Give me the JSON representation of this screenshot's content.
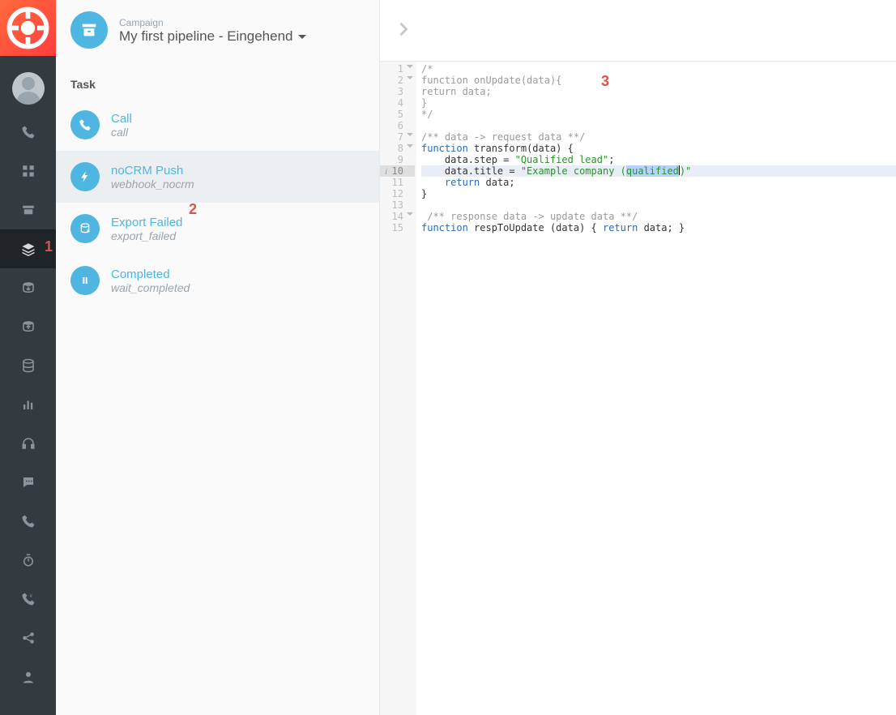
{
  "campaign": {
    "label": "Campaign",
    "name": "My first pipeline - Eingehend"
  },
  "section": {
    "title": "Task"
  },
  "tasks": [
    {
      "title": "Call",
      "sub": "call",
      "icon": "phone",
      "selected": false
    },
    {
      "title": "noCRM Push",
      "sub": "webhook_nocrm",
      "icon": "bolt",
      "selected": true
    },
    {
      "title": "Export Failed",
      "sub": "export_failed",
      "icon": "export",
      "selected": false
    },
    {
      "title": "Completed",
      "sub": "wait_completed",
      "icon": "pause",
      "selected": false
    }
  ],
  "code": {
    "lines": [
      {
        "n": 1,
        "fold": true,
        "tokens": [
          {
            "t": "/*",
            "c": "cm-comment"
          }
        ]
      },
      {
        "n": 2,
        "fold": true,
        "tokens": [
          {
            "t": "function onUpdate(data){",
            "c": "cm-comment"
          }
        ]
      },
      {
        "n": 3,
        "tokens": [
          {
            "t": "return data;",
            "c": "cm-comment"
          }
        ]
      },
      {
        "n": 4,
        "tokens": [
          {
            "t": "}",
            "c": "cm-comment"
          }
        ]
      },
      {
        "n": 5,
        "tokens": [
          {
            "t": "*/",
            "c": "cm-comment"
          }
        ]
      },
      {
        "n": 6,
        "tokens": [
          {
            "t": "",
            "c": ""
          }
        ]
      },
      {
        "n": 7,
        "fold": true,
        "tokens": [
          {
            "t": "/** data -> request data **/",
            "c": "cm-comment"
          }
        ]
      },
      {
        "n": 8,
        "fold": true,
        "tokens": [
          {
            "t": "function",
            "c": "cm-kw"
          },
          {
            "t": " "
          },
          {
            "t": "transform",
            "c": "cm-fn"
          },
          {
            "t": "(data) {"
          }
        ]
      },
      {
        "n": 9,
        "tokens": [
          {
            "t": "    data.step = "
          },
          {
            "t": "\"Qualified lead\"",
            "c": "cm-str"
          },
          {
            "t": ";"
          }
        ]
      },
      {
        "n": 10,
        "hl": true,
        "info": true,
        "tokens": [
          {
            "t": "    data.title = "
          },
          {
            "t": "\"Example company (",
            "c": "cm-str"
          },
          {
            "t": "qualified",
            "c": "cm-str cm-sel"
          },
          {
            "t": "",
            "cursor": true
          },
          {
            "t": ")\"",
            "c": "cm-str"
          }
        ]
      },
      {
        "n": 11,
        "tokens": [
          {
            "t": "    "
          },
          {
            "t": "return",
            "c": "cm-kw"
          },
          {
            "t": " data;"
          }
        ]
      },
      {
        "n": 12,
        "tokens": [
          {
            "t": "}"
          }
        ]
      },
      {
        "n": 13,
        "tokens": [
          {
            "t": "",
            "c": ""
          }
        ]
      },
      {
        "n": 14,
        "fold": true,
        "tokens": [
          {
            "t": " "
          },
          {
            "t": "/** response data -> update data **/",
            "c": "cm-comment"
          }
        ]
      },
      {
        "n": 15,
        "tokens": [
          {
            "t": "function",
            "c": "cm-kw"
          },
          {
            "t": " "
          },
          {
            "t": "respToUpdate",
            "c": "cm-fn"
          },
          {
            "t": " (data) { "
          },
          {
            "t": "return",
            "c": "cm-kw"
          },
          {
            "t": " data; }"
          }
        ]
      }
    ]
  },
  "annotations": {
    "a1": "1",
    "a2": "2",
    "a3": "3"
  },
  "rail_icons": [
    "phone",
    "grid",
    "archive",
    "stack",
    "db-in",
    "db-out",
    "database",
    "bar-chart",
    "headphones",
    "chat",
    "phone2",
    "stopwatch",
    "redial",
    "share",
    "user"
  ]
}
